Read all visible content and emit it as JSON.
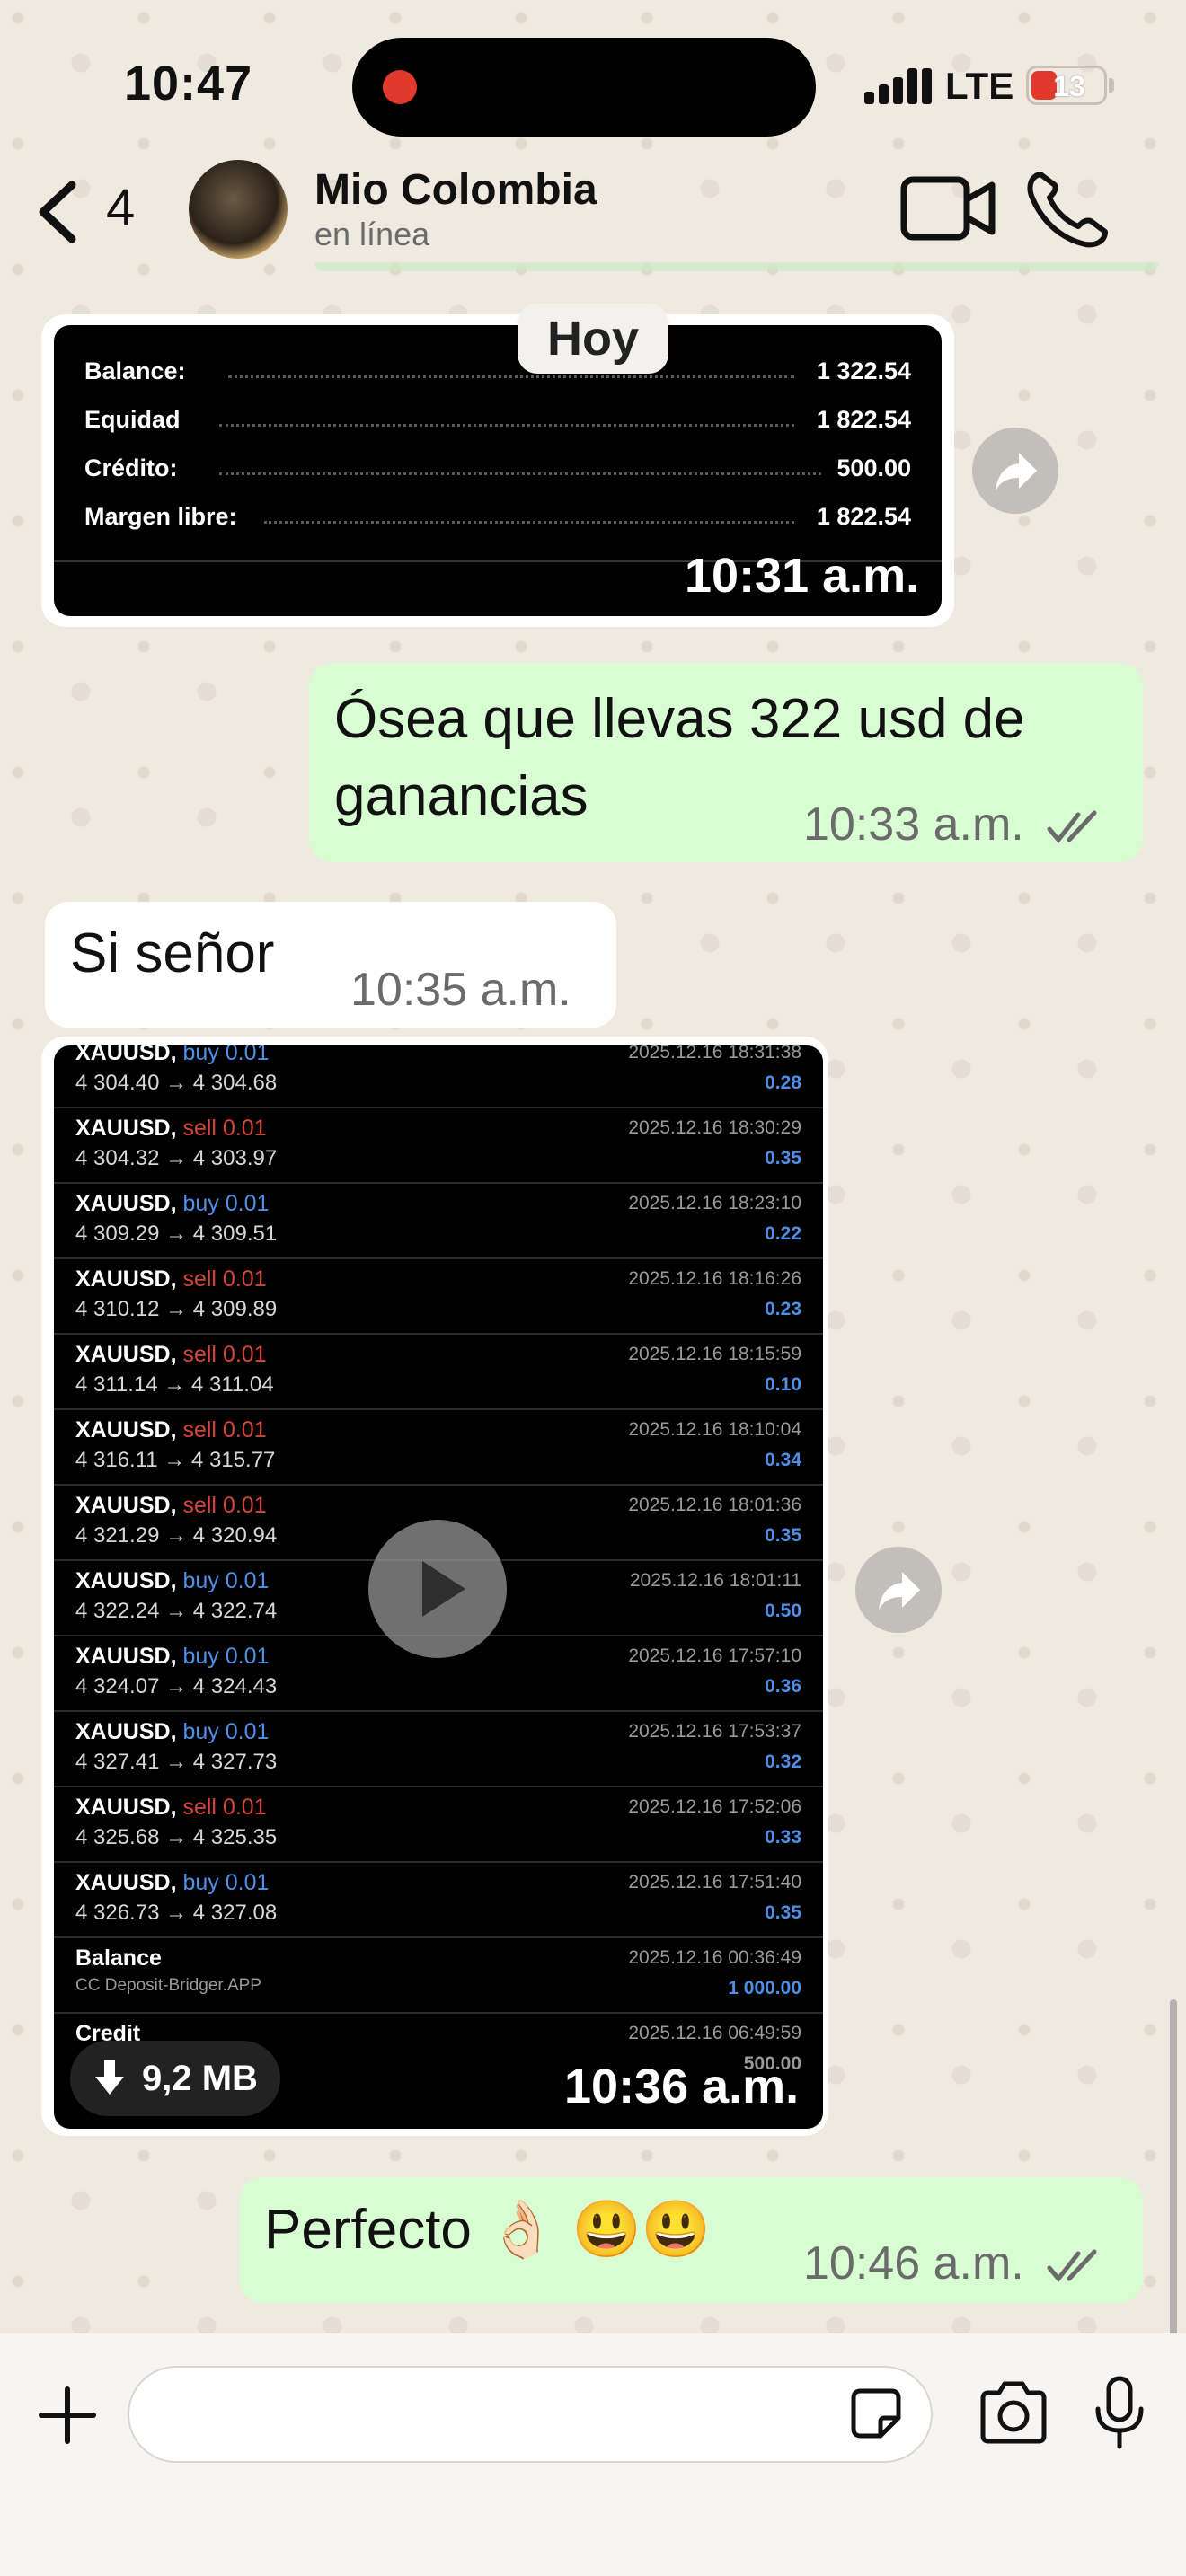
{
  "status_bar": {
    "time": "10:47",
    "network": "LTE",
    "battery": "13"
  },
  "header": {
    "back_count": "4",
    "contact_name": "Mio Colombia",
    "contact_status": "en línea",
    "icons": [
      "chevron-left-icon",
      "video-call-icon",
      "phone-icon"
    ]
  },
  "date_chip": "Hoy",
  "messages": [
    {
      "type": "image",
      "direction": "in",
      "time": "10:31 a.m.",
      "image": {
        "rows": [
          {
            "label": "Balance:",
            "value": "1 322.54"
          },
          {
            "label": "Equidad",
            "value": "1 822.54"
          },
          {
            "label": "Crédito:",
            "value": "500.00"
          },
          {
            "label": "Margen libre:",
            "value": "1 822.54"
          }
        ]
      }
    },
    {
      "type": "text",
      "direction": "out",
      "text_line1": "Ósea que llevas 322 usd de",
      "text_line2": "ganancias",
      "time": "10:33 a.m."
    },
    {
      "type": "text",
      "direction": "in",
      "text": "Si señor",
      "time": "10:35 a.m."
    },
    {
      "type": "video",
      "direction": "in",
      "time": "10:36 a.m.",
      "size": "9,2 MB",
      "trades": [
        {
          "symbol": "XAUUSD,",
          "side": "buy",
          "lot": "0.01",
          "price": "4 304.40 → 4 304.68",
          "date": "2025.12.16 18:31:38",
          "value": "0.28"
        },
        {
          "symbol": "XAUUSD,",
          "side": "sell",
          "lot": "0.01",
          "price": "4 304.32 → 4 303.97",
          "date": "2025.12.16 18:30:29",
          "value": "0.35"
        },
        {
          "symbol": "XAUUSD,",
          "side": "buy",
          "lot": "0.01",
          "price": "4 309.29 → 4 309.51",
          "date": "2025.12.16 18:23:10",
          "value": "0.22"
        },
        {
          "symbol": "XAUUSD,",
          "side": "sell",
          "lot": "0.01",
          "price": "4 310.12 → 4 309.89",
          "date": "2025.12.16 18:16:26",
          "value": "0.23"
        },
        {
          "symbol": "XAUUSD,",
          "side": "sell",
          "lot": "0.01",
          "price": "4 311.14 → 4 311.04",
          "date": "2025.12.16 18:15:59",
          "value": "0.10"
        },
        {
          "symbol": "XAUUSD,",
          "side": "sell",
          "lot": "0.01",
          "price": "4 316.11 → 4 315.77",
          "date": "2025.12.16 18:10:04",
          "value": "0.34"
        },
        {
          "symbol": "XAUUSD,",
          "side": "sell",
          "lot": "0.01",
          "price": "4 321.29 → 4 320.94",
          "date": "2025.12.16 18:01:36",
          "value": "0.35"
        },
        {
          "symbol": "XAUUSD,",
          "side": "buy",
          "lot": "0.01",
          "price": "4 322.24 → 4 322.74",
          "date": "2025.12.16 18:01:11",
          "value": "0.50"
        },
        {
          "symbol": "XAUUSD,",
          "side": "buy",
          "lot": "0.01",
          "price": "4 324.07 → 4 324.43",
          "date": "2025.12.16 17:57:10",
          "value": "0.36"
        },
        {
          "symbol": "XAUUSD,",
          "side": "buy",
          "lot": "0.01",
          "price": "4 327.41 → 4 327.73",
          "date": "2025.12.16 17:53:37",
          "value": "0.32"
        },
        {
          "symbol": "XAUUSD,",
          "side": "sell",
          "lot": "0.01",
          "price": "4 325.68 → 4 325.35",
          "date": "2025.12.16 17:52:06",
          "value": "0.33"
        },
        {
          "symbol": "XAUUSD,",
          "side": "buy",
          "lot": "0.01",
          "price": "4 326.73 → 4 327.08",
          "date": "2025.12.16 17:51:40",
          "value": "0.35"
        }
      ],
      "balance_row": {
        "label": "Balance",
        "sub": "CC Deposit-Bridger.APP",
        "date": "2025.12.16 00:36:49",
        "value": "1 000.00"
      },
      "credit_row": {
        "label": "Credit",
        "date": "2025.12.16 06:49:59",
        "value": "500.00"
      }
    },
    {
      "type": "text",
      "direction": "out",
      "text": "Perfecto 👌🏻 😃😃",
      "time": "10:46 a.m."
    }
  ],
  "composer": {
    "placeholder": ""
  }
}
